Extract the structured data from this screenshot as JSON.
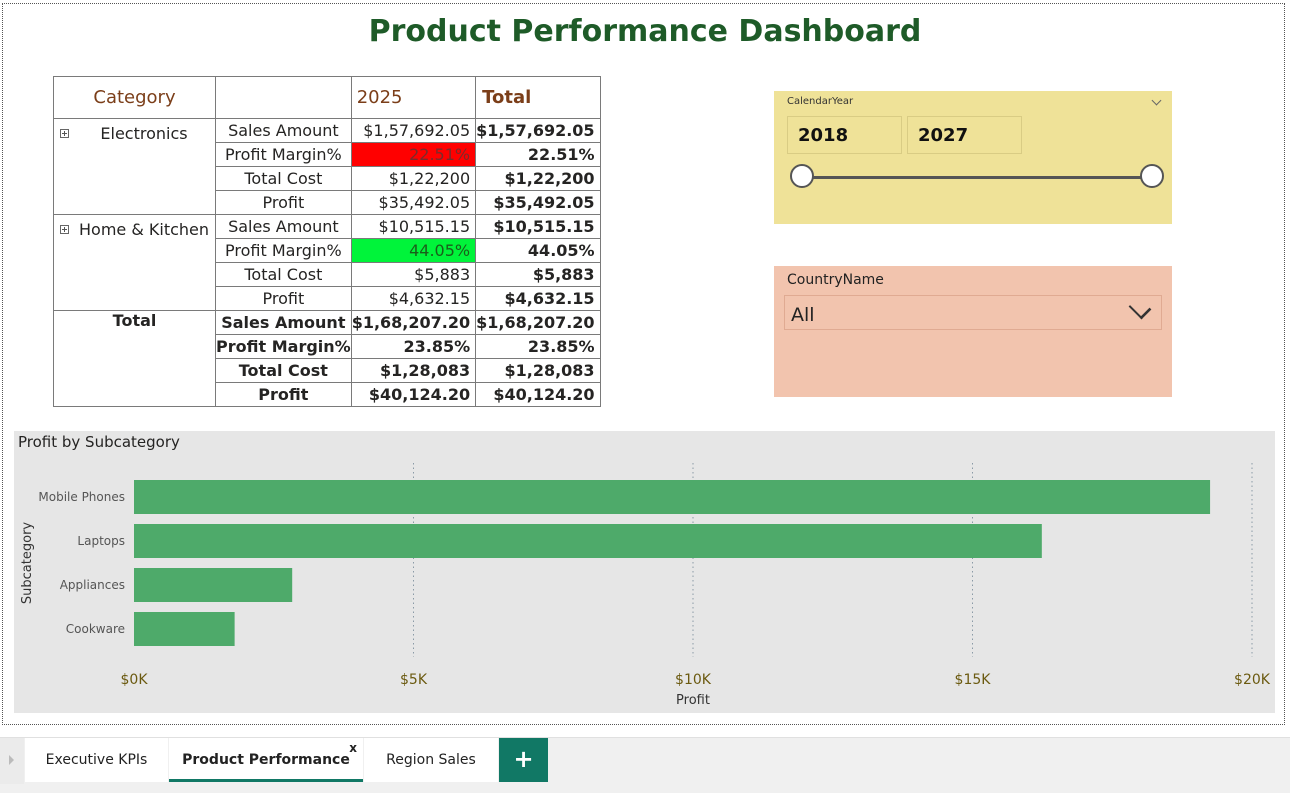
{
  "page": {
    "title": "Product Performance Dashboard"
  },
  "matrix": {
    "header": {
      "category": "Category",
      "blank": "",
      "year": "2025",
      "total": "Total"
    },
    "groups": [
      {
        "category": "Electronics",
        "rows": [
          {
            "measure": "Sales Amount",
            "y2025": "$1,57,692.05",
            "total": "$1,57,692.05"
          },
          {
            "measure": "Profit Margin%",
            "y2025": "22.51%",
            "total": "22.51%",
            "highlight": "#ff0000"
          },
          {
            "measure": "Total Cost",
            "y2025": "$1,22,200",
            "total": "$1,22,200"
          },
          {
            "measure": "Profit",
            "y2025": "$35,492.05",
            "total": "$35,492.05"
          }
        ]
      },
      {
        "category": "Home & Kitchen",
        "rows": [
          {
            "measure": "Sales Amount",
            "y2025": "$10,515.15",
            "total": "$10,515.15"
          },
          {
            "measure": "Profit Margin%",
            "y2025": "44.05%",
            "total": "44.05%",
            "highlight": "#00f43a"
          },
          {
            "measure": "Total Cost",
            "y2025": "$5,883",
            "total": "$5,883"
          },
          {
            "measure": "Profit",
            "y2025": "$4,632.15",
            "total": "$4,632.15"
          }
        ]
      }
    ],
    "total": {
      "label": "Total",
      "rows": [
        {
          "measure": "Sales Amount",
          "y2025": "$1,68,207.20",
          "total": "$1,68,207.20"
        },
        {
          "measure": "Profit Margin%",
          "y2025": "23.85%",
          "total": "23.85%"
        },
        {
          "measure": "Total Cost",
          "y2025": "$1,28,083",
          "total": "$1,28,083"
        },
        {
          "measure": "Profit",
          "y2025": "$40,124.20",
          "total": "$40,124.20"
        }
      ]
    }
  },
  "year_slicer": {
    "label": "CalendarYear",
    "start": "2018",
    "end": "2027",
    "chevron_icon": "chevron-down-icon"
  },
  "country_slicer": {
    "label": "CountryName",
    "value": "All",
    "chevron_icon": "chevron-down-icon"
  },
  "chart_data": {
    "type": "bar",
    "orientation": "horizontal",
    "title": "Profit by Subcategory",
    "xlabel": "Profit",
    "ylabel": "Subcategory",
    "categories": [
      "Mobile Phones",
      "Laptops",
      "Appliances",
      "Cookware"
    ],
    "values": [
      19250,
      16240,
      2830,
      1800
    ],
    "xlim": [
      0,
      20000
    ],
    "xticks": [
      "$0K",
      "$5K",
      "$10K",
      "$15K",
      "$20K"
    ],
    "bar_color": "#4eaa6a",
    "grid": "dotted vertical"
  },
  "tabs": [
    {
      "label": "Executive KPIs",
      "active": false
    },
    {
      "label": "Product Performance",
      "active": true,
      "close": "x"
    },
    {
      "label": "Region Sales",
      "active": false
    }
  ],
  "add_tab": {
    "label": "+"
  }
}
